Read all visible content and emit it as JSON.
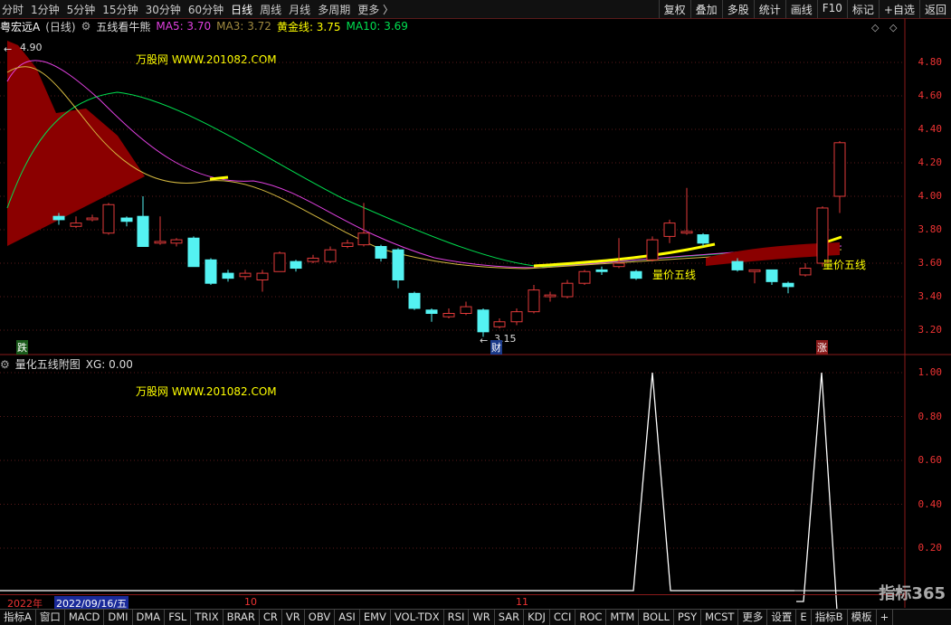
{
  "topbar": {
    "periods": [
      "分时",
      "1分钟",
      "5分钟",
      "15分钟",
      "30分钟",
      "60分钟",
      "日线",
      "周线",
      "月线",
      "多周期",
      "更多 〉"
    ],
    "active": "日线",
    "right_buttons": [
      "复权",
      "叠加",
      "多股",
      "统计",
      "画线",
      "F10",
      "标记",
      "+自选",
      "返回"
    ]
  },
  "info": {
    "stock": "粤宏远A",
    "period": "(日线)",
    "indicator": "五线看牛熊",
    "ma5": "MA5: 3.70",
    "ma3": "MA3: 3.72",
    "gold": "黄金线: 3.75",
    "ma10": "MA10: 3.69"
  },
  "watermark": "万股网 WWW.201082.COM",
  "price_axis": [
    "4.80",
    "4.60",
    "4.40",
    "4.20",
    "4.00",
    "3.80",
    "3.60",
    "3.40",
    "3.20"
  ],
  "sub_axis": [
    "1.00",
    "0.80",
    "0.60",
    "0.40",
    "0.20"
  ],
  "labels": {
    "high": "4.90",
    "low": "3.15",
    "die": "跌",
    "cai": "财",
    "zhang": "涨",
    "lvwx1": "量价五线",
    "lvwx2": "量价五线"
  },
  "panel2": {
    "title": "量化五线附图",
    "xg": "XG: 0.00"
  },
  "datebar": {
    "year": "2022年",
    "cursor": "2022/09/16/五",
    "m10": "10",
    "m11": "11"
  },
  "tabs": [
    "指标A",
    "窗口",
    "MACD",
    "DMI",
    "DMA",
    "FSL",
    "TRIX",
    "BRAR",
    "CR",
    "VR",
    "OBV",
    "ASI",
    "EMV",
    "VOL-TDX",
    "RSI",
    "WR",
    "SAR",
    "KDJ",
    "CCI",
    "ROC",
    "MTM",
    "BOLL",
    "PSY",
    "MCST",
    "更多",
    "设置",
    "E",
    "指标B",
    "模板",
    "+"
  ],
  "logo": "指标365",
  "colors": {
    "up": "#e23a3a",
    "down": "#54f2f2",
    "ma5": "#f0f0f0",
    "ma3": "#d4b840",
    "gold": "#ffff00",
    "ma10": "#00e050",
    "magenta": "#e040e0"
  }
}
